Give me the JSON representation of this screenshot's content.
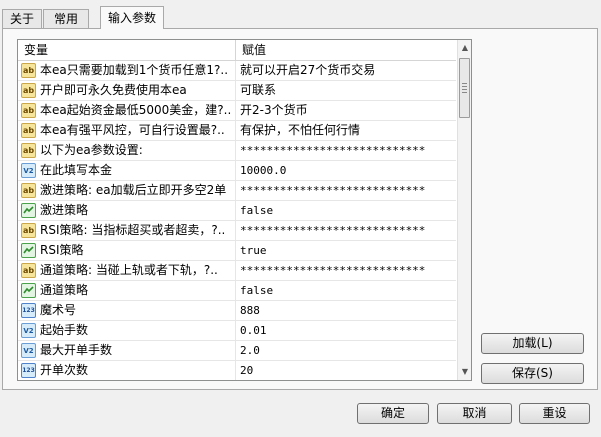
{
  "tabs": [
    {
      "label": "关于",
      "active": false
    },
    {
      "label": "常用",
      "active": false
    },
    {
      "label": "输入参数",
      "active": true
    }
  ],
  "grid": {
    "headers": {
      "name": "变量",
      "value": "赋值"
    },
    "rows": [
      {
        "icon": "ab",
        "name": "本ea只需要加载到1个货币任意1?..",
        "value": "就可以开启27个货币交易"
      },
      {
        "icon": "ab",
        "name": "开户即可永久免费使用本ea",
        "value": "可联系"
      },
      {
        "icon": "ab",
        "name": "本ea起始资金最低5000美金，建?..",
        "value": "开2-3个货币"
      },
      {
        "icon": "ab",
        "name": "本ea有强平风控，可自行设置最?..",
        "value": "有保护，不怕任何行情"
      },
      {
        "icon": "ab",
        "name": "以下为ea参数设置:",
        "value": "****************************"
      },
      {
        "icon": "v2",
        "name": "在此填写本金",
        "value": "10000.0"
      },
      {
        "icon": "ab",
        "name": "激进策略: ea加载后立即开多空2单",
        "value": "****************************"
      },
      {
        "icon": "bool",
        "name": "激进策略",
        "value": "false"
      },
      {
        "icon": "ab",
        "name": "RSI策略: 当指标超买或者超卖，?..",
        "value": "****************************"
      },
      {
        "icon": "bool",
        "name": "RSI策略",
        "value": "true"
      },
      {
        "icon": "ab",
        "name": "通道策略: 当碰上轨或者下轨，?..",
        "value": "****************************"
      },
      {
        "icon": "bool",
        "name": "通道策略",
        "value": "false"
      },
      {
        "icon": "num",
        "name": "魔术号",
        "value": "888"
      },
      {
        "icon": "v2",
        "name": "起始手数",
        "value": "0.01"
      },
      {
        "icon": "v2",
        "name": "最大开单手数",
        "value": "2.0"
      },
      {
        "icon": "num",
        "name": "开单次数",
        "value": "20"
      },
      {
        "icon": "v2",
        "name": "",
        "value": ""
      }
    ]
  },
  "buttons": {
    "load": "加载(L)",
    "save": "保存(S)",
    "ok": "确定",
    "cancel": "取消",
    "reset": "重设"
  }
}
